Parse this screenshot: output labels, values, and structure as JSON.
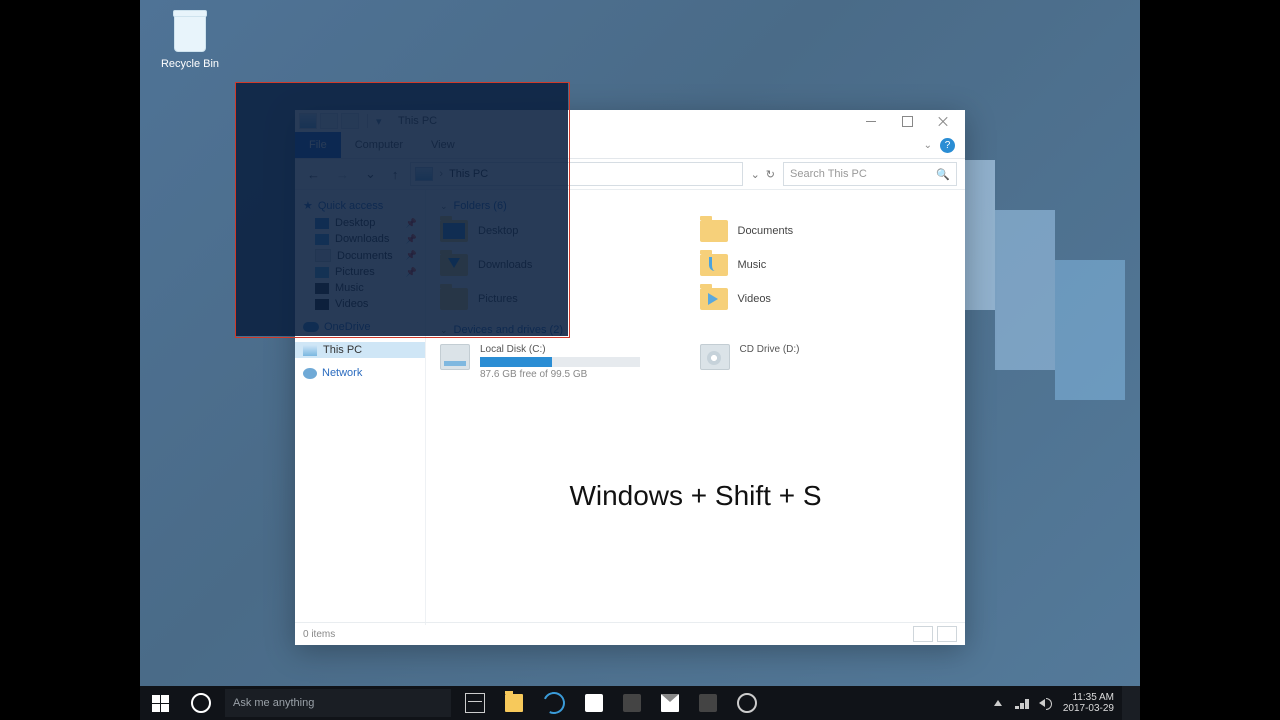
{
  "desktop": {
    "recycle_bin": "Recycle Bin"
  },
  "taskbar": {
    "search_placeholder": "Ask me anything",
    "time": "11:35 AM",
    "date": "2017-03-29"
  },
  "explorer": {
    "title": "This PC",
    "tabs": {
      "file": "File",
      "computer": "Computer",
      "view": "View"
    },
    "help": "?",
    "address": {
      "crumb": "This PC",
      "refresh_glyph": "↻",
      "dropdown_glyph": "⌄"
    },
    "search_placeholder": "Search This PC",
    "nav": {
      "quick_access": "Quick access",
      "items": [
        {
          "label": "Desktop",
          "pin": "📌"
        },
        {
          "label": "Downloads",
          "pin": "📌"
        },
        {
          "label": "Documents",
          "pin": "📌"
        },
        {
          "label": "Pictures",
          "pin": "📌"
        },
        {
          "label": "Music",
          "pin": ""
        },
        {
          "label": "Videos",
          "pin": ""
        }
      ],
      "onedrive": "OneDrive",
      "this_pc": "This PC",
      "network": "Network"
    },
    "sections": {
      "folders_header": "Folders (6)",
      "folders": [
        {
          "name": "Desktop"
        },
        {
          "name": "Documents"
        },
        {
          "name": "Downloads"
        },
        {
          "name": "Music"
        },
        {
          "name": "Pictures"
        },
        {
          "name": "Videos"
        }
      ],
      "drives_header": "Devices and drives (2)",
      "drives": [
        {
          "name": "Local Disk (C:)",
          "sub": "87.6 GB free of 99.5 GB"
        },
        {
          "name": "CD Drive (D:)",
          "sub": ""
        }
      ]
    },
    "overlay_text": "Windows + Shift + S",
    "status": "0 items"
  }
}
